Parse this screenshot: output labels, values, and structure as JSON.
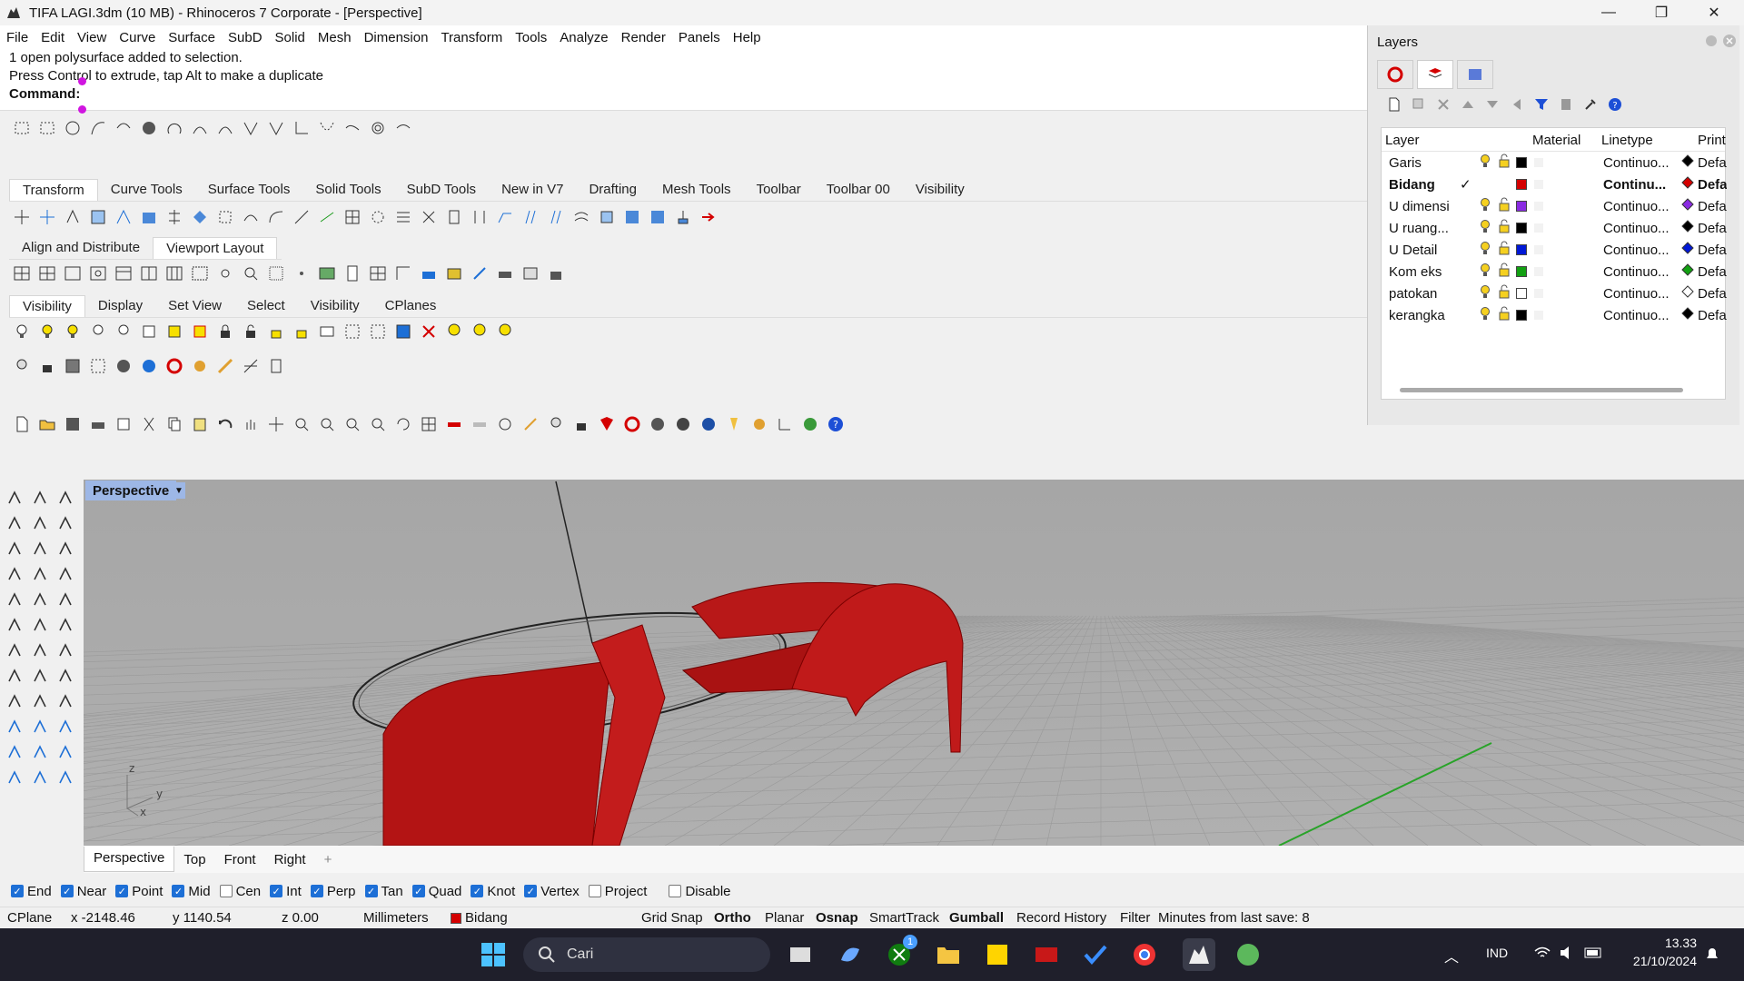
{
  "window": {
    "title": "TIFA LAGI.3dm (10 MB) - Rhinoceros 7 Corporate - [Perspective]",
    "minimize": "—",
    "restore": "❐",
    "close": "✕"
  },
  "menu": [
    "File",
    "Edit",
    "View",
    "Curve",
    "Surface",
    "SubD",
    "Solid",
    "Mesh",
    "Dimension",
    "Transform",
    "Tools",
    "Analyze",
    "Render",
    "Panels",
    "Help"
  ],
  "command": {
    "line1": "1 open polysurface added to selection.",
    "line2": "Press Control to extrude, tap Alt to make a duplicate",
    "prompt": "Command:"
  },
  "toolbar_tabs_1": [
    "Transform",
    "Curve Tools",
    "Surface Tools",
    "Solid Tools",
    "SubD Tools",
    "New in V7",
    "Drafting",
    "Mesh Tools",
    "Toolbar",
    "Toolbar 00",
    "Visibility"
  ],
  "toolbar_tabs_2": [
    "Align and Distribute",
    "Viewport Layout"
  ],
  "toolbar_tabs_3": [
    "Visibility",
    "Display",
    "Set View",
    "Select",
    "Visibility",
    "CPlanes"
  ],
  "layers_panel": {
    "title": "Layers",
    "columns": {
      "layer": "Layer",
      "material": "Material",
      "linetype": "Linetype",
      "print": "Print W"
    },
    "rows": [
      {
        "name": "Garis",
        "current": false,
        "color": "#000000",
        "linetype": "Continuo...",
        "print": "Defau",
        "bold": false
      },
      {
        "name": "Bidang",
        "current": true,
        "color": "#d40000",
        "linetype": "Continu...",
        "print": "Defau",
        "bold": true
      },
      {
        "name": "U dimensi",
        "current": false,
        "color": "#8a2be2",
        "linetype": "Continuo...",
        "print": "Defau",
        "bold": false
      },
      {
        "name": "U ruang...",
        "current": false,
        "color": "#000000",
        "linetype": "Continuo...",
        "print": "Defau",
        "bold": false
      },
      {
        "name": "U Detail",
        "current": false,
        "color": "#0018d6",
        "linetype": "Continuo...",
        "print": "Defau",
        "bold": false
      },
      {
        "name": "Kom eks",
        "current": false,
        "color": "#12a012",
        "linetype": "Continuo...",
        "print": "Defau",
        "bold": false
      },
      {
        "name": "patokan",
        "current": false,
        "color": "#ffffff",
        "linetype": "Continuo...",
        "print": "Defau",
        "bold": false
      },
      {
        "name": "kerangka",
        "current": false,
        "color": "#000000",
        "linetype": "Continuo...",
        "print": "Defau",
        "bold": false
      }
    ],
    "check": "✓"
  },
  "viewport": {
    "label": "Perspective",
    "axes": {
      "z": "z",
      "y": "y",
      "x": "x"
    },
    "tabs": [
      "Perspective",
      "Top",
      "Front",
      "Right"
    ],
    "add_tab": "+"
  },
  "osnaps": [
    {
      "label": "End",
      "on": true
    },
    {
      "label": "Near",
      "on": true
    },
    {
      "label": "Point",
      "on": true
    },
    {
      "label": "Mid",
      "on": true
    },
    {
      "label": "Cen",
      "on": false
    },
    {
      "label": "Int",
      "on": true
    },
    {
      "label": "Perp",
      "on": true
    },
    {
      "label": "Tan",
      "on": true
    },
    {
      "label": "Quad",
      "on": true
    },
    {
      "label": "Knot",
      "on": true
    },
    {
      "label": "Vertex",
      "on": true
    },
    {
      "label": "Project",
      "on": false
    },
    {
      "label": "Disable",
      "on": false
    }
  ],
  "status": {
    "cplane": "CPlane",
    "x": "x -2148.46",
    "y": "y 1140.54",
    "z": "z 0.00",
    "units": "Millimeters",
    "layer": "Bidang",
    "layer_color": "#d40000",
    "grid_snap": "Grid Snap",
    "ortho": "Ortho",
    "planar": "Planar",
    "osnap": "Osnap",
    "smarttrack": "SmartTrack",
    "gumball": "Gumball",
    "record_history": "Record History",
    "filter": "Filter",
    "minutes": "Minutes from last save: 8"
  },
  "taskbar": {
    "search": "Cari",
    "lang": "IND",
    "time": "13.33",
    "date": "21/10/2024",
    "xbox_badge": "1"
  },
  "colors": {
    "accent_blue": "#1d6fd6",
    "model_red": "#c21a1a",
    "viewport_bg": "#a8a8a8"
  }
}
